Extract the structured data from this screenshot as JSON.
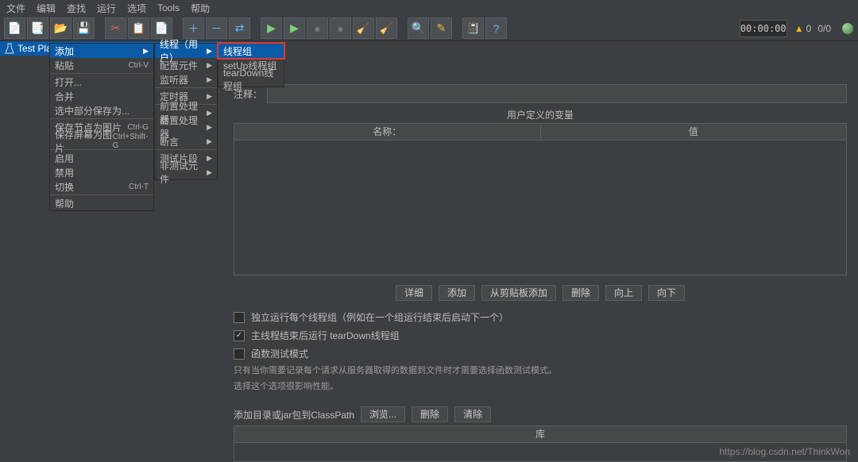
{
  "menubar": [
    "文件",
    "编辑",
    "查找",
    "运行",
    "选项",
    "Tools",
    "帮助"
  ],
  "toolbar_icons": [
    {
      "name": "new-file-icon",
      "glyph": "📄",
      "color": "#eee",
      "sep": false
    },
    {
      "name": "templates-icon",
      "glyph": "📑",
      "color": "#eee",
      "sep": false
    },
    {
      "name": "open-icon",
      "glyph": "📂",
      "color": "#e8b931",
      "sep": false
    },
    {
      "name": "save-icon",
      "glyph": "💾",
      "color": "#ddd",
      "sep": true
    },
    {
      "name": "cut-icon",
      "glyph": "✂",
      "color": "#d66",
      "sep": false
    },
    {
      "name": "copy-icon",
      "glyph": "📋",
      "color": "#ddd",
      "sep": false
    },
    {
      "name": "paste-icon",
      "glyph": "📄",
      "color": "#e8b931",
      "sep": true
    },
    {
      "name": "expand-icon",
      "glyph": "＋",
      "color": "#6ab0ff",
      "sep": false
    },
    {
      "name": "collapse-icon",
      "glyph": "－",
      "color": "#6ab0ff",
      "sep": false
    },
    {
      "name": "toggle-icon",
      "glyph": "⇄",
      "color": "#6ab0ff",
      "sep": true
    },
    {
      "name": "start-icon",
      "glyph": "▶",
      "color": "#7bd47b",
      "sep": false
    },
    {
      "name": "start-no-timers-icon",
      "glyph": "▶",
      "color": "#7bd47b",
      "sep": false
    },
    {
      "name": "stop-icon",
      "glyph": "●",
      "color": "#777",
      "sep": false
    },
    {
      "name": "shutdown-icon",
      "glyph": "●",
      "color": "#777",
      "sep": false
    },
    {
      "name": "clear-icon",
      "glyph": "🧹",
      "color": "#e8b931",
      "sep": false
    },
    {
      "name": "clear-all-icon",
      "glyph": "🧹",
      "color": "#e8b931",
      "sep": true
    },
    {
      "name": "search-icon",
      "glyph": "🔍",
      "color": "#ddd",
      "sep": false
    },
    {
      "name": "reset-search-icon",
      "glyph": "✎",
      "color": "#e8b931",
      "sep": true
    },
    {
      "name": "function-helper-icon",
      "glyph": "📓",
      "color": "#6ab0ff",
      "sep": false
    },
    {
      "name": "help-icon",
      "glyph": "?",
      "color": "#6ab0ff",
      "sep": false
    }
  ],
  "status": {
    "time": "00:00:00",
    "warn_count": "0",
    "active": "0/0"
  },
  "tree": {
    "root_label": "Test Plan"
  },
  "ctx_menu": [
    {
      "label": "添加",
      "short": "",
      "arrow": true,
      "hi": true
    },
    {
      "label": "粘贴",
      "short": "Ctrl-V"
    },
    {
      "sep": true
    },
    {
      "label": "打开..."
    },
    {
      "label": "合并"
    },
    {
      "label": "选中部分保存为..."
    },
    {
      "sep": true
    },
    {
      "label": "保存节点为图片",
      "short": "Ctrl-G"
    },
    {
      "label": "保存屏幕为图片",
      "short": "Ctrl+Shift-G"
    },
    {
      "sep": true
    },
    {
      "label": "启用"
    },
    {
      "label": "禁用"
    },
    {
      "label": "切换",
      "short": "Ctrl-T"
    },
    {
      "sep": true
    },
    {
      "label": "帮助"
    }
  ],
  "sub_menu": [
    {
      "label": "线程（用户）",
      "arrow": true,
      "hi": true
    },
    {
      "label": "配置元件",
      "arrow": true
    },
    {
      "label": "监听器",
      "arrow": true
    },
    {
      "sep": true
    },
    {
      "label": "定时器",
      "arrow": true
    },
    {
      "sep": true
    },
    {
      "label": "前置处理器",
      "arrow": true
    },
    {
      "label": "后置处理器",
      "arrow": true
    },
    {
      "label": "断言",
      "arrow": true
    },
    {
      "sep": true
    },
    {
      "label": "测试片段",
      "arrow": true
    },
    {
      "label": "非测试元件",
      "arrow": true
    }
  ],
  "sub2_menu": [
    {
      "label": "线程组",
      "hi": true,
      "red": true
    },
    {
      "label": "setUp线程组"
    },
    {
      "label": "tearDown线程组"
    }
  ],
  "form": {
    "comment_label": "注释：",
    "vars_title": "用户定义的变量",
    "col_name": "名称：",
    "col_value": "值"
  },
  "buttons": {
    "detail": "详细",
    "add": "添加",
    "addclip": "从剪贴板添加",
    "delete": "删除",
    "up": "向上",
    "down": "向下",
    "browse": "浏览...",
    "del2": "删除",
    "clear": "清除"
  },
  "checks": {
    "c1": "独立运行每个线程组（例如在一个组运行结束后启动下一个）",
    "c2": "主线程结束后运行 tearDown线程组",
    "c3": "函数测试模式"
  },
  "note1": "只有当你需要记录每个请求从服务器取得的数据到文件时才需要选择函数测试模式。",
  "note2": "选择这个选项很影响性能。",
  "classpath_label": "添加目录或jar包到ClassPath",
  "lib_header": "库",
  "watermark": "https://blog.csdn.net/ThinkWon"
}
